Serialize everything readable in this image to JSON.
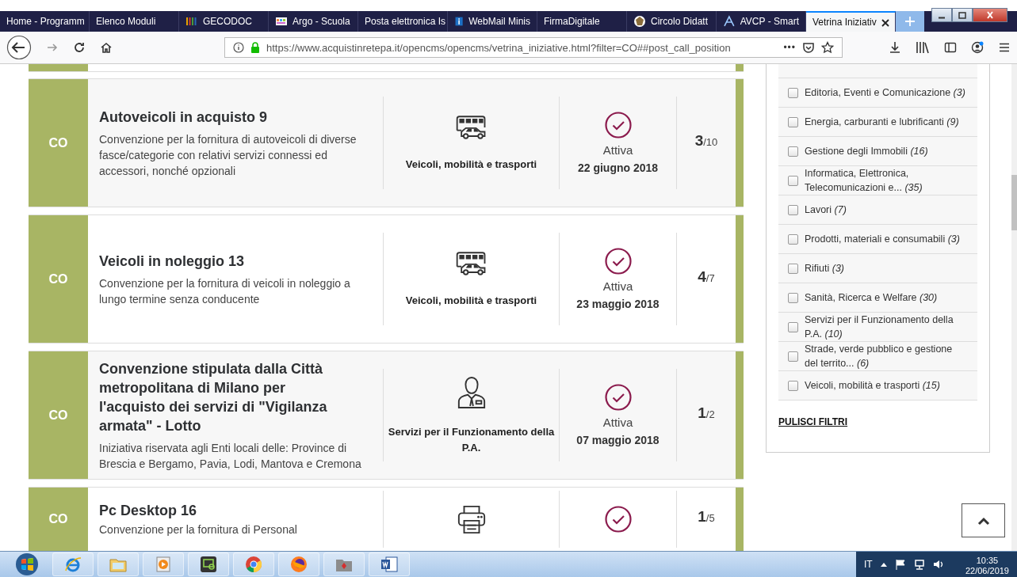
{
  "browser": {
    "tabs": [
      {
        "label": "Home - Programm",
        "selected": false
      },
      {
        "label": "Elenco Moduli",
        "selected": false
      },
      {
        "label": "GECODOC",
        "selected": false
      },
      {
        "label": "Argo - Scuola",
        "selected": false
      },
      {
        "label": "Posta elettronica Is",
        "selected": false
      },
      {
        "label": "WebMail Minis",
        "selected": false
      },
      {
        "label": "FirmaDigitale",
        "selected": false
      },
      {
        "label": "Circolo Didatt",
        "selected": false
      },
      {
        "label": "AVCP - Smart",
        "selected": false
      },
      {
        "label": "Vetrina Iniziativ",
        "selected": true
      }
    ],
    "url": "https://www.acquistinretepa.it/opencms/opencms/vetrina_iniziative.html?filter=CO##post_call_position",
    "page_actions": "•••"
  },
  "initiatives": [
    {
      "type": "CO",
      "title": "Autoveicoli in acquisto 9",
      "description": "Convenzione per la fornitura di autoveicoli di diverse fasce/categorie con relativi servizi connessi ed accessori, nonché opzionali",
      "kind": "vehicles",
      "category": "Veicoli, mobilità e trasporti",
      "status": "Attiva",
      "date": "22 giugno 2018",
      "lot": "3",
      "lots_total": "/10"
    },
    {
      "type": "CO",
      "title": "Veicoli in noleggio 13",
      "description": "Convenzione per la fornitura di veicoli in noleggio a lungo termine senza conducente",
      "kind": "vehicles",
      "category": "Veicoli, mobilità e trasporti",
      "status": "Attiva",
      "date": "23 maggio 2018",
      "lot": "4",
      "lots_total": "/7"
    },
    {
      "type": "CO",
      "title": "Convenzione stipulata dalla Città metropolitana di Milano per l'acquisto dei servizi di \"Vigilanza armata\" - Lotto",
      "description": "Iniziativa riservata agli Enti locali delle: Province di Brescia e Bergamo, Pavia, Lodi, Mantova e Cremona",
      "kind": "person",
      "category": "Servizi per il Funzionamento della P.A.",
      "status": "Attiva",
      "date": "07 maggio 2018",
      "lot": "1",
      "lots_total": "/2"
    },
    {
      "type": "CO",
      "title": "Pc Desktop 16",
      "description": "Convenzione per la fornitura di Personal",
      "kind": "printer",
      "lot": "1",
      "lots_total": "/5"
    }
  ],
  "filters": {
    "items": [
      {
        "label": "Editoria, Eventi e Comunicazione *(3)*",
        "checked": false
      },
      {
        "label": "Energia, carburanti e lubrificanti *(9)*",
        "checked": false
      },
      {
        "label": "Gestione degli Immobili *(16)*",
        "checked": false
      },
      {
        "label": "Informatica, Elettronica, Telecomunicazioni e... *(35)*",
        "checked": false
      },
      {
        "label": "Lavori *(7)*",
        "checked": false
      },
      {
        "label": "Prodotti, materiali e consumabili *(3)*",
        "checked": false
      },
      {
        "label": "Rifiuti *(3)*",
        "checked": false
      },
      {
        "label": "Sanità, Ricerca e Welfare *(30)*",
        "checked": false
      },
      {
        "label": "Servizi per il Funzionamento della P.A. *(10)*",
        "checked": false
      },
      {
        "label": "Strade, verde pubblico e gestione del territo... *(6)*",
        "checked": false
      },
      {
        "label": "Veicoli, mobilità e trasporti *(15)*",
        "checked": false
      }
    ],
    "clear_link": "PULISCI FILTRI"
  },
  "taskbar": {
    "language": "IT",
    "time": "10:35",
    "date": "22/06/2019"
  }
}
